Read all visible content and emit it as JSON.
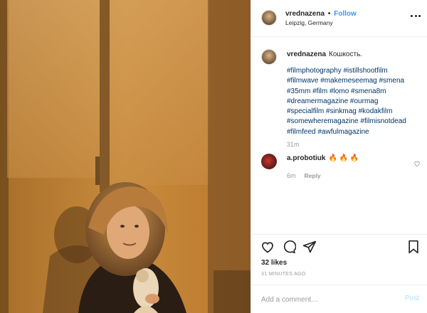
{
  "post": {
    "username": "vrednazena",
    "dot": "•",
    "follow_label": "Follow",
    "location": "Leipzig, Germany",
    "more_icon": "more-horizontal-icon"
  },
  "caption": {
    "username": "vrednazena",
    "text": "Кошкость.",
    "hashtag_lines": [
      "#filmphotography #istillshootfilm",
      "#filmwave #makemeseemag #smena",
      "#35mm #film #lomo #smena8m",
      "#dreamermagazine #ourmag",
      "#specialfilm #sinkmag #kodakfilm",
      "#somewheremagazine #filmisnotdead",
      "#filmfeed #awfulmagazine"
    ],
    "time": "31m"
  },
  "comment": {
    "username": "a.probotiuk",
    "text": "🔥 🔥 🔥",
    "time": "6m",
    "reply_label": "Reply",
    "like_icon": "heart-outline-icon"
  },
  "actions": {
    "like_icon": "heart-icon",
    "comment_icon": "comment-icon",
    "share_icon": "share-icon",
    "save_icon": "bookmark-icon"
  },
  "likes": "32 likes",
  "time_ago": "31 MINUTES AGO",
  "add_comment": {
    "placeholder": "Add a comment…",
    "post_label": "Post"
  },
  "colors": {
    "link_blue": "#3897f0",
    "hashtag": "#003569",
    "muted": "#999999",
    "post_disabled": "#b2dffc"
  }
}
